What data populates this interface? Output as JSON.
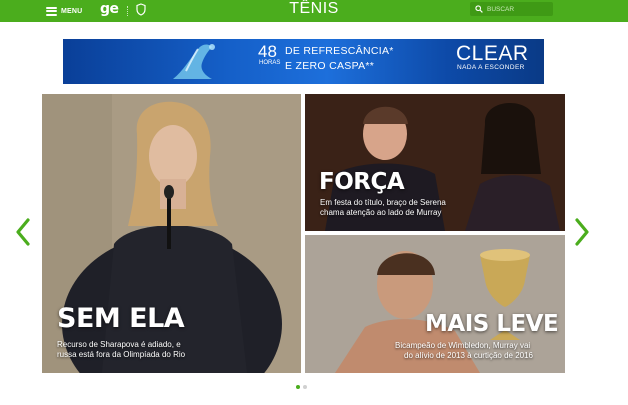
{
  "header": {
    "menu_label": "MENU",
    "logo_text": "ge",
    "section_title": "TÊNIS",
    "search_placeholder": "BUSCAR",
    "icons": [
      "menu-icon",
      "shield-icon",
      "search-icon"
    ]
  },
  "ad": {
    "number": "48",
    "unit": "HORAS",
    "line1": "DE REFRESCÂNCIA*",
    "line2": "E ZERO CASPA**",
    "brand": "CLEAR",
    "tagline": "NADA A ESCONDER"
  },
  "carousel": {
    "cards": [
      {
        "headline": "SEM ELA",
        "subtitle_line1": "Recurso de Sharapova é adiado, e",
        "subtitle_line2": "russa está fora da Olimpíada do Rio"
      },
      {
        "headline": "FORÇA",
        "subtitle_line1": "Em festa do título, braço de Serena",
        "subtitle_line2": "chama atenção ao lado de Murray"
      },
      {
        "headline": "MAIS LEVE",
        "subtitle_line1": "Bicampeão de Wimbledon, Murray vai",
        "subtitle_line2": "do alívio de 2013 à curtição de 2016"
      }
    ],
    "active_page": 1,
    "page_count": 2
  },
  "colors": {
    "brand_green": "#4bad1d",
    "ad_blue": "#1560c9",
    "inactive_dot": "#d0d0d0"
  }
}
